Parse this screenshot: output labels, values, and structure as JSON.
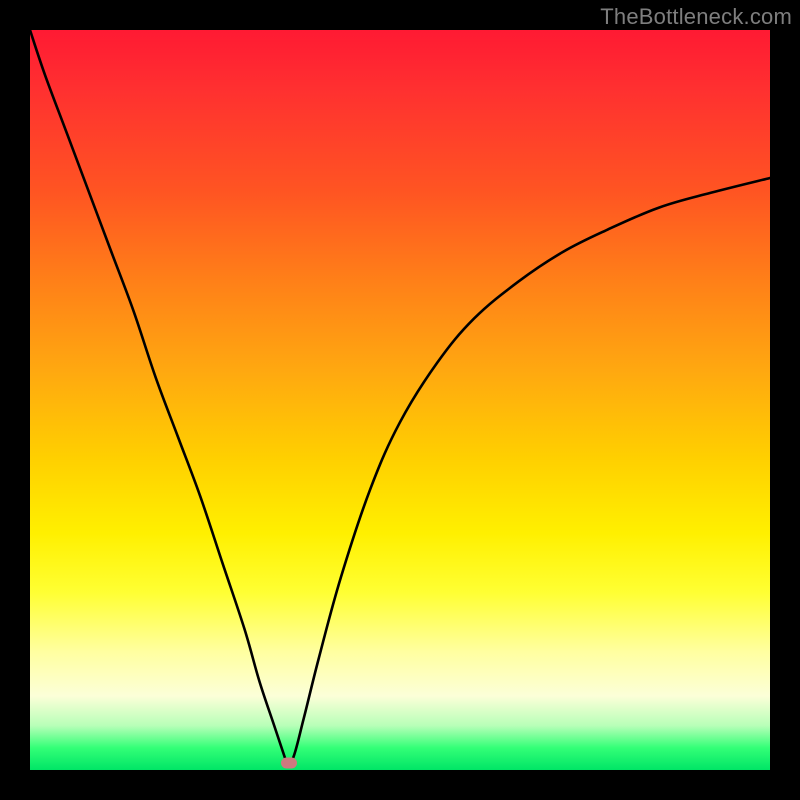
{
  "watermark": "TheBottleneck.com",
  "colors": {
    "frame": "#000000",
    "curve": "#000000",
    "marker": "#cc7a7f",
    "gradient_top": "#ff1a33",
    "gradient_bottom": "#00e566"
  },
  "chart_data": {
    "type": "line",
    "title": "",
    "xlabel": "",
    "ylabel": "",
    "xlim": [
      0,
      100
    ],
    "ylim": [
      0,
      100
    ],
    "grid": false,
    "legend": false,
    "description": "V-shaped bottleneck curve over a vertical red-to-green gradient. The curve drops from the top-left, reaches a sharp minimum near x≈35, then rises toward the right with decreasing slope.",
    "x": [
      0,
      2,
      5,
      8,
      11,
      14,
      17,
      20,
      23,
      26,
      29,
      31,
      33,
      34.5,
      35.5,
      37,
      39,
      42,
      46,
      50,
      55,
      60,
      66,
      72,
      78,
      85,
      92,
      100
    ],
    "y": [
      100,
      94,
      86,
      78,
      70,
      62,
      53,
      45,
      37,
      28,
      19,
      12,
      6,
      1.5,
      1.5,
      7,
      15,
      26,
      38,
      47,
      55,
      61,
      66,
      70,
      73,
      76,
      78,
      80
    ],
    "marker": {
      "x": 35,
      "y": 1
    }
  }
}
